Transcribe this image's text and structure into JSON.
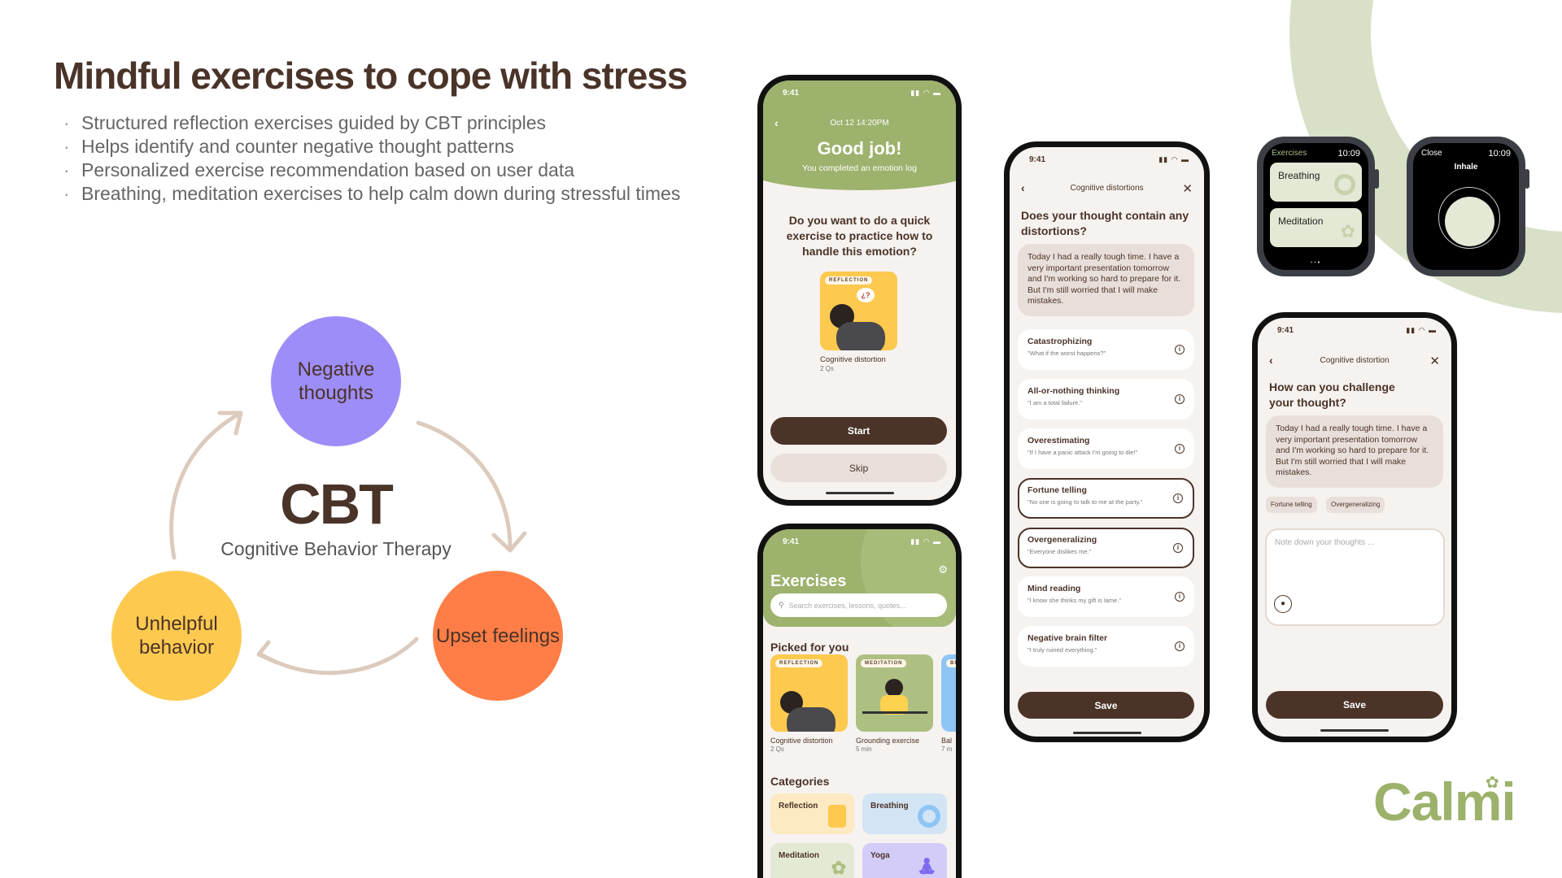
{
  "slide": {
    "title": "Mindful exercises to cope with stress",
    "bullets": [
      "Structured reflection exercises guided by CBT principles",
      "Helps identify and counter negative thought patterns",
      "Personalized exercise recommendation based on user data",
      "Breathing, meditation exercises to help calm down during stressful times"
    ],
    "logo": "Calmi"
  },
  "cbt": {
    "title": "CBT",
    "subtitle": "Cognitive Behavior Therapy",
    "nodes": [
      "Negative thoughts",
      "Upset feelings",
      "Unhelpful behavior"
    ],
    "colors": {
      "thoughts": "#9d8df8",
      "feelings": "#ff7e47",
      "behavior": "#fdc94f",
      "arrow": "#dccbbd"
    }
  },
  "colors": {
    "brand_green": "#9cb26b",
    "header_green": "#9db26d",
    "dark_brown": "#4b3328",
    "bg": "#f6f2ef"
  },
  "phone_emotion": {
    "time": "9:41",
    "date": "Oct 12 14:20PM",
    "heading": "Good job!",
    "subheading": "You completed an emotion log",
    "question": "Do you want to do a quick exercise to practice how to handle this emotion?",
    "card": {
      "tag": "REFLECTION",
      "title": "Cognitive distortion",
      "meta": "2 Qs"
    },
    "start": "Start",
    "skip": "Skip"
  },
  "phone_exercises": {
    "time": "9:41",
    "title": "Exercises",
    "search_placeholder": "Search exercises, lessons, quotes...",
    "picked_title": "Picked for you",
    "picked": [
      {
        "tag": "REFLECTION",
        "title": "Cognitive distortion",
        "meta": "2 Qs"
      },
      {
        "tag": "MEDITATION",
        "title": "Grounding exercise",
        "meta": "5 min"
      },
      {
        "tag": "BR",
        "title": "Bal",
        "meta": "7 m"
      }
    ],
    "categories_title": "Categories",
    "categories": [
      "Reflection",
      "Breathing",
      "Meditation",
      "Yoga"
    ]
  },
  "phone_distortions": {
    "time": "9:41",
    "header": "Cognitive distortions",
    "question": "Does your thought contain any distortions?",
    "thought": "Today I had a really tough time. I have a very important presentation tomorrow and I'm working so hard to prepare for it. But I'm still worried that I will make mistakes.",
    "items": [
      {
        "name": "Catastrophizing",
        "example": "\"What if the worst happens?\"",
        "selected": false
      },
      {
        "name": "All-or-nothing thinking",
        "example": "\"I am a total failure.\"",
        "selected": false
      },
      {
        "name": "Overestimating",
        "example": "\"If I have a panic attack I'm going to die!\"",
        "selected": false
      },
      {
        "name": "Fortune telling",
        "example": "\"No one is going to talk to me at the party.\"",
        "selected": true
      },
      {
        "name": "Overgeneralizing",
        "example": "\"Everyone dislikes me.\"",
        "selected": true
      },
      {
        "name": "Mind reading",
        "example": "\"I know she thinks my gift is lame.\"",
        "selected": false
      },
      {
        "name": "Negative brain filter",
        "example": "\"I truly ruined everything.\"",
        "selected": false
      }
    ],
    "save": "Save"
  },
  "phone_challenge": {
    "time": "9:41",
    "header": "Cognitive distortion",
    "question": "How can you challenge your thought?",
    "thought": "Today I had a really tough time. I have a very important presentation tomorrow and I'm working so hard to prepare for it. But I'm still worried that I will make mistakes.",
    "chips": [
      "Fortune telling",
      "Overgeneralizing"
    ],
    "placeholder": "Note down your thoughts ...",
    "save": "Save"
  },
  "watch_list": {
    "title": "Exercises",
    "time": "10:09",
    "items": [
      "Breathing",
      "Meditation"
    ],
    "page_dots": 3,
    "active_dot": 3
  },
  "watch_breathe": {
    "close": "Close",
    "time": "10:09",
    "phase": "Inhale"
  }
}
